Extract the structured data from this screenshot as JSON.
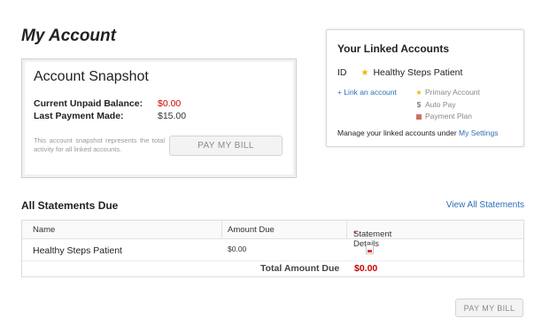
{
  "page": {
    "title": "My Account"
  },
  "snapshot": {
    "title": "Account Snapshot",
    "unpaid_label": "Current Unpaid Balance:",
    "unpaid_value": "$0.00",
    "last_payment_label": "Last Payment Made:",
    "last_payment_value": "$15.00",
    "note": "This account snapshot represents the total activity for all linked accounts.",
    "pay_button": "PAY MY BILL"
  },
  "linked": {
    "title": "Your Linked Accounts",
    "id_label": "ID",
    "account_name": "Healthy Steps Patient",
    "link_account": "+ Link an account",
    "legend": {
      "primary": "Primary Account",
      "autopay": "Auto Pay",
      "plan": "Payment Plan"
    },
    "manage_text": "Manage your linked accounts under",
    "settings_link": "My Settings"
  },
  "statements": {
    "title": "All Statements Due",
    "view_all": "View All Statements",
    "columns": {
      "name": "Name",
      "amount": "Amount Due",
      "details": "Statement Details",
      "required_mark": "*"
    },
    "rows": [
      {
        "name": "Healthy Steps Patient",
        "amount": "$0.00"
      }
    ],
    "total_label": "Total Amount Due",
    "total_value": "$0.00"
  },
  "footer": {
    "pay_button": "PAY MY BILL"
  },
  "colors": {
    "link": "#2a6fb8",
    "alert": "#cc0000",
    "star": "#f4b400"
  },
  "icons": {
    "primary": "star-icon",
    "autopay": "autopay-icon",
    "plan": "calendar-icon",
    "statement": "pdf-icon"
  }
}
